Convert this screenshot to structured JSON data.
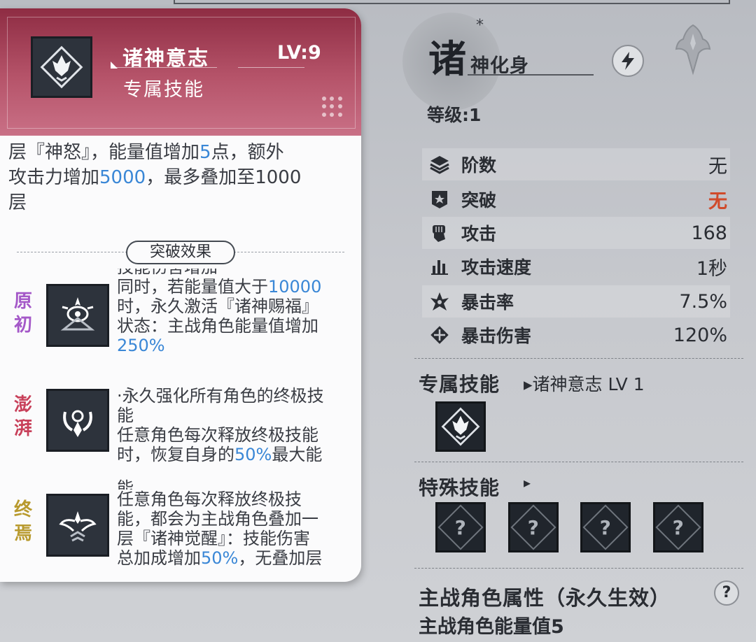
{
  "skill_card": {
    "title": "诸神意志",
    "level": "LV:9",
    "type": "专属技能",
    "desc_lines_before": "层『神怒』，能量值增加",
    "desc_energy": "5",
    "desc_after_energy": "点，额外",
    "desc_atk_pre": "攻击力增加",
    "desc_atk_val": "5000",
    "desc_atk_post": "，最多叠加至1000",
    "desc_last": "层",
    "break_label": "突破效果",
    "stages": [
      {
        "tag_top": "原",
        "tag_bottom": "初",
        "tag_color": "#a458c8",
        "icon": "eye-crest-icon",
        "cut_line": "技能伤害增加",
        "line1_pre": "同时，若能量值大于",
        "line1_val": "10000",
        "line2": "时，永久激活『诸神赐福』",
        "line3": "状态：主战角色能量值增加",
        "line4_val": "250%"
      },
      {
        "tag_top": "澎",
        "tag_bottom": "湃",
        "tag_color": "#c8405a",
        "icon": "flame-ring-icon",
        "line1": "·永久强化所有角色的终极技",
        "line2": "能",
        "line3": "任意角色每次释放终极技能",
        "line4_pre": "时，恢复自身的",
        "line4_val": "50%",
        "line4_post": "最大能"
      },
      {
        "tag_top": "终",
        "tag_bottom": "焉",
        "tag_color": "#b89a2e",
        "icon": "winged-crest-icon",
        "cut_line": "能",
        "line1": "任意角色每次释放终极技",
        "line2": "能，都会为主战角色叠加一",
        "line3": "层『诸神觉醒』：技能伤害",
        "line4_pre": "总加成增加",
        "line4_val": "50%",
        "line4_post": "，无叠加层"
      }
    ]
  },
  "character": {
    "initial": "诸",
    "star": "*",
    "name": "神化身",
    "level": "等级:1"
  },
  "stats": [
    {
      "icon": "layers-icon",
      "label": "阶数",
      "value": "无",
      "red": false
    },
    {
      "icon": "breakthrough-icon",
      "label": "突破",
      "value": "无",
      "red": true
    },
    {
      "icon": "fist-icon",
      "label": "攻击",
      "value": "168",
      "red": false
    },
    {
      "icon": "bars-icon",
      "label": "攻击速度",
      "value": "1秒",
      "red": false
    },
    {
      "icon": "crit-rate-icon",
      "label": "暴击率",
      "value": "7.5%",
      "red": false
    },
    {
      "icon": "crit-damage-icon",
      "label": "暴击伤害",
      "value": "120%",
      "red": false
    }
  ],
  "exclusive_skill": {
    "title": "专属技能",
    "sub": "▸诸神意志 LV 1"
  },
  "special_skill": {
    "title": "特殊技能",
    "arrow": "▸",
    "slots": [
      "?",
      "?",
      "?",
      "?"
    ]
  },
  "main_attr": {
    "title": "主战角色属性（永久生效）",
    "value": "主战角色能量值5",
    "help": "?"
  }
}
